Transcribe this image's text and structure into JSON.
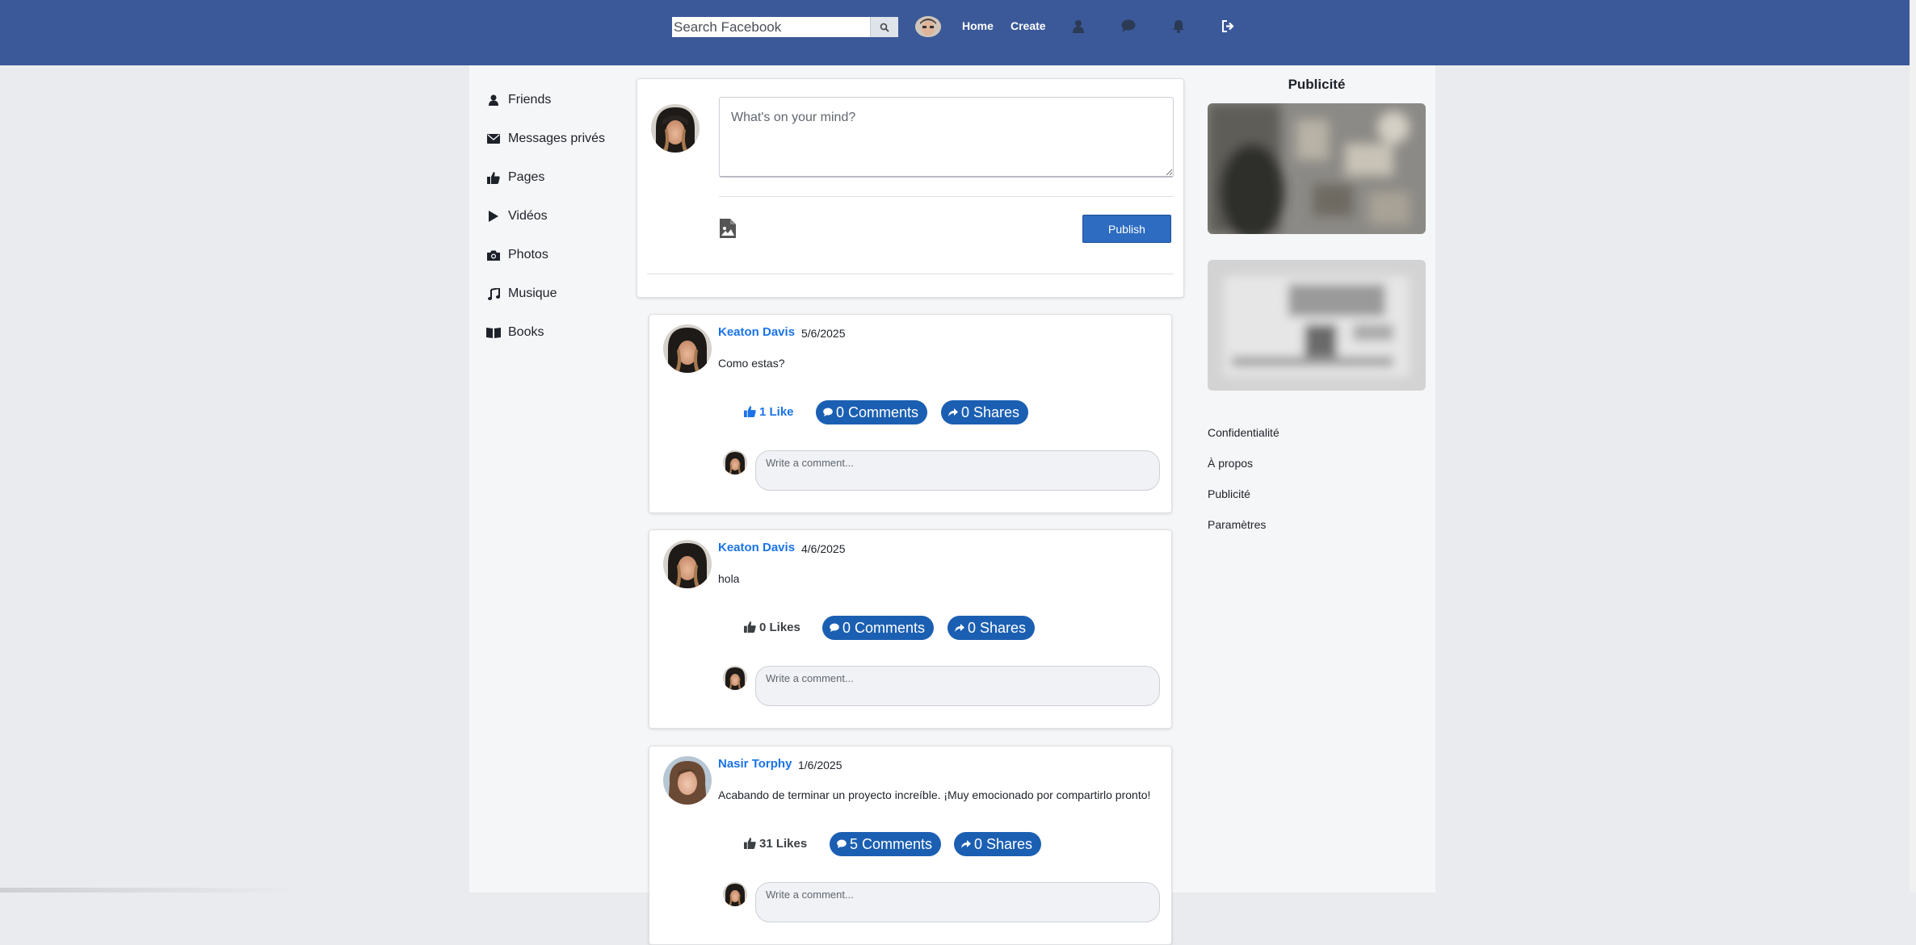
{
  "header": {
    "search_placeholder": "Search Facebook",
    "nav": {
      "home": "Home",
      "create": "Create"
    },
    "icons": [
      "search-icon",
      "user-icon",
      "chat-icon",
      "bell-icon",
      "logout-icon"
    ]
  },
  "sidebar": {
    "items": [
      {
        "label": "Friends",
        "icon": "user-icon"
      },
      {
        "label": "Messages privés",
        "icon": "envelope-icon"
      },
      {
        "label": "Pages",
        "icon": "thumbs-up-icon"
      },
      {
        "label": "Vidéos",
        "icon": "play-icon"
      },
      {
        "label": "Photos",
        "icon": "camera-icon"
      },
      {
        "label": "Musique",
        "icon": "music-icon"
      },
      {
        "label": "Books",
        "icon": "book-icon"
      }
    ]
  },
  "composer": {
    "placeholder": "What's on your mind?",
    "publish_label": "Publish"
  },
  "posts": [
    {
      "author": "Keaton Davis",
      "date": "5/6/2025",
      "text": "Como estas?",
      "likes_label": "1 Like",
      "liked": true,
      "comments_label": "0 Comments",
      "shares_label": "0 Shares",
      "comment_placeholder": "Write a comment..."
    },
    {
      "author": "Keaton Davis",
      "date": "4/6/2025",
      "text": "hola",
      "likes_label": "0 Likes",
      "liked": false,
      "comments_label": "0 Comments",
      "shares_label": "0 Shares",
      "comment_placeholder": "Write a comment..."
    },
    {
      "author": "Nasir Torphy",
      "date": "1/6/2025",
      "text": "Acabando de terminar un proyecto increíble. ¡Muy emocionado por compartirlo pronto!",
      "likes_label": "31 Likes",
      "liked": false,
      "comments_label": "5 Comments",
      "shares_label": "0 Shares",
      "comment_placeholder": "Write a comment..."
    }
  ],
  "right_column": {
    "ads_title": "Publicité",
    "footer_links": [
      "Confidentialité",
      "À propos",
      "Publicité",
      "Paramètres"
    ]
  },
  "colors": {
    "header_bg": "#3b5998",
    "link_blue": "#1a73e8",
    "pill_blue": "#1b5fb2",
    "publish_blue": "#2d6cc0",
    "page_bg": "#e9ebee"
  }
}
